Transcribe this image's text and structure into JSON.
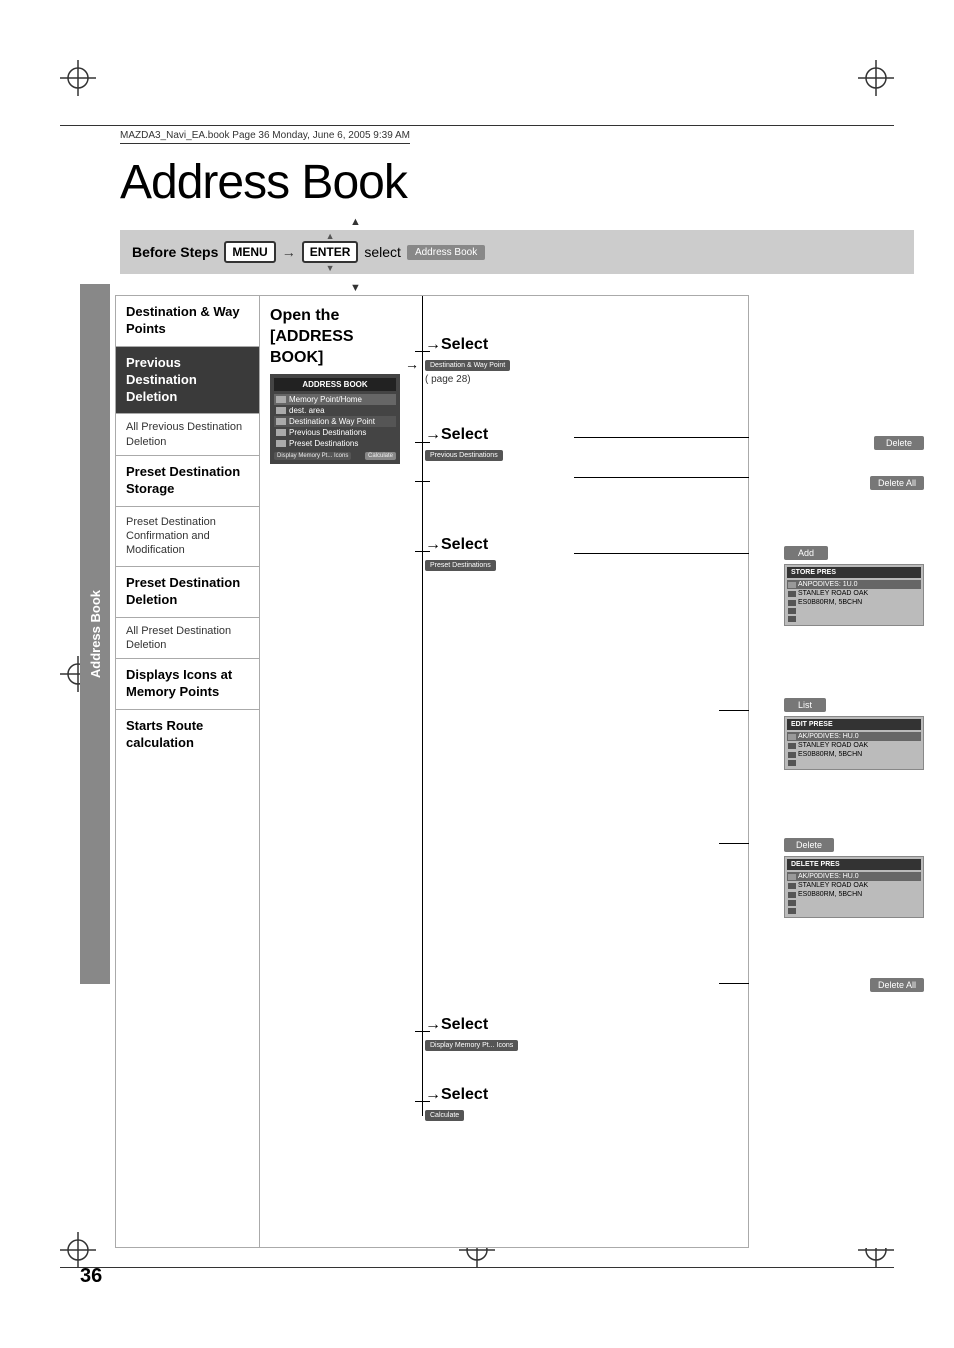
{
  "page": {
    "title": "Address Book",
    "number": "36",
    "file_info": "MAZDA3_Navi_EA.book  Page 36  Monday, June 6, 2005  9:39 AM"
  },
  "before_steps": {
    "label": "Before Steps",
    "menu_key": "MENU",
    "enter_key": "ENTER",
    "select_label": "select",
    "address_book_chip": "Address Book"
  },
  "open_box": {
    "title_line1": "Open the",
    "title_line2": "[ADDRESS",
    "title_line3": "BOOK]",
    "menu_title": "ADDRESS BOOK",
    "menu_items": [
      "Memory Point/Home",
      "dest. area",
      "Destination & Way Point",
      "Previous Destinations",
      "Preset Destinations"
    ],
    "bottom_buttons": [
      "Display Memory Pt... Icons",
      "Calculate"
    ]
  },
  "vertical_label": "Address Book",
  "flow_sections": [
    {
      "id": "destination_waypoints",
      "label": "Destination & Way Points",
      "bold": true,
      "select_chip": "Destination & Way Point",
      "select_note": "( page 28)"
    },
    {
      "id": "previous_destination_deletion",
      "label": "Previous Destination Deletion",
      "bold": true,
      "select_chip": "Previous Destinations",
      "right_button": "Delete"
    },
    {
      "id": "all_previous_deletion",
      "label": "All Previous Destination Deletion",
      "bold": false,
      "right_button": "Delete All"
    },
    {
      "id": "preset_destination_storage",
      "label": "Preset Destination Storage",
      "bold": true,
      "select_chip": "Preset Destinations",
      "right_button": "Add",
      "panel_title": "STORE PRES",
      "panel_rows": [
        "ANPODIVES: 1U.0",
        "STANLEY ROAD OAK",
        "ES0B80RM, 5BCHN",
        "",
        ""
      ]
    },
    {
      "id": "preset_destination_confirmation",
      "label": "Preset Destination Confirmation and Modification",
      "bold": false,
      "right_button": "List",
      "panel_title": "EDIT PRESE",
      "panel_rows": [
        "AK/P0DIVES: HU.0",
        "STANLEY ROAD OAK",
        "ES0B80RM, 5BCHN",
        ""
      ]
    },
    {
      "id": "preset_destination_deletion",
      "label": "Preset Destination Deletion",
      "bold": true,
      "right_button": "Delete",
      "panel_title": "DELETE PRES",
      "panel_rows": [
        "AK/P0DIVES: HU.0",
        "STANLEY ROAD OAK",
        "ES0B80RM, 5BCHN",
        "",
        ""
      ]
    },
    {
      "id": "all_preset_deletion",
      "label": "All Preset Destination Deletion",
      "bold": false,
      "right_button": "Delete All"
    },
    {
      "id": "displays_icons",
      "label": "Displays Icons at Memory Points",
      "bold": true,
      "select_chip": "Display Memory Pt... Icons"
    },
    {
      "id": "starts_route",
      "label": "Starts Route calculation",
      "bold": true,
      "select_chip": "Calculate"
    }
  ]
}
